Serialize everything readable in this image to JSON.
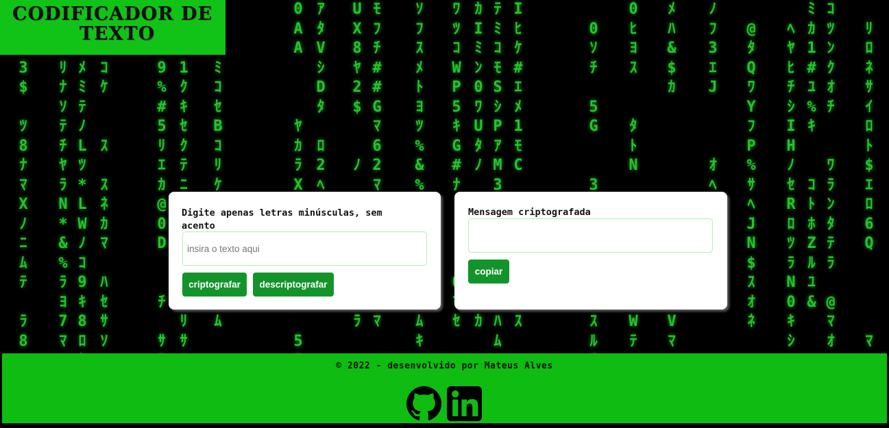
{
  "header": {
    "logo_line1": "CODIFICADOR DE",
    "logo_line2": "TEXTO"
  },
  "input_card": {
    "label": "Digite apenas letras minúsculas, sem acento",
    "placeholder": "insira o texto aqui",
    "encrypt_button": "criptografar",
    "decrypt_button": "descriptografar"
  },
  "output_card": {
    "label": "Mensagem criptografada",
    "copy_button": "copiar"
  },
  "footer": {
    "credit": "© 2022 - desenvolvido por Mateus Alves",
    "links": [
      "github-icon",
      "linkedin-icon"
    ]
  },
  "colors": {
    "rain_green": "#22c52a",
    "header_green": "#11c316",
    "footer_green": "#0fbc12",
    "button_green": "#13942a"
  },
  "background_rain": [
    "ﾀ\nﾊ\nP\n3\n$\n\nﾂ\n8\nﾅ\nﾏ\nX\nﾉ\nﾆ\nﾑ\nﾃ\n\nﾗ\n8\n%",
    "\n\nﾙ\nﾘ\nﾅ\nｿ\nﾃ\nﾁ\nﾔ\nﾗ\nN\n*\n&\n%\nﾗ\nﾖ\n7\nﾏ",
    "\n\nﾁ\nﾒ\nﾐ\nﾃ\nﾉ\nL\nﾂ\n*\nL\nW\nﾉ\nｺ\n9\nｷ\n8\nﾛ\nｾ",
    "\n\nﾂ\nｺ\nｹ\n\n\nｽ\n\nｽ\nﾈ\nｶ\nﾏ\n\nﾊ\nｾ\nｻ\nｿ",
    "\n\nﾀ\n9\n%\n#\n5\nﾘ\nｴ\nｶ\n@\n0\nD\n\n\nﾁ\n\nｻ\n9",
    "\nﾅ\nﾀ\n1\nｸ\nｷ\nｾ\nｸ\nﾃ\nﾆ\nｸ\nﾐ\nｵ\n\n\n\nﾘ\nｻ\nﾂ",
    "\n\nｿ\nﾐ\nｺ\nｾ\nB\nｺ\nﾘ\nｹ\nS\n\n\n\nﾘ\nﾈ\nﾑ",
    "0\nA\nA\n\n\n\nﾔ\nｶ\nﾗ\nX\n\n\n\n\n\n\n\n5\n0",
    "ｱ\nﾀ\nV\nｼ\nD\nﾀ\n\nﾛ\n2\nﾍ\n\n\n\n\nﾅ\nｽ",
    "U\nX\n8\nﾔ\n2\n$\n\n\nﾉ\n\n\n\n\n\n\nﾌ\nﾗ",
    "ﾓ\nﾌ\nﾁ\n#\n#\nG\nﾏ\n6\n2\nﾏ\n\n\n\n\n\nﾊ\nﾏ",
    "ｿ\nﾌ\nｽ\nﾒ\nﾄ\nﾖ\nﾂ\n%\n&\n%\n\n\n\n\n\n\nﾑ\nｷ",
    "ﾜ\nﾂ\nｺ\nW\nP\n5\nｷ\nG\n#\nﾅ\n\n\n\n\n0\nﾏ\nｾ",
    "ｶ\nI\nﾐ\nﾝ\n0\nﾜ\nU\nﾀ\nﾉ\n\n\n\n\n\n\n\nｶ",
    "ﾃ\nﾐ\nｺ\nﾓ\nS\nｼ\nP\nｱ\nM\n3\n\n\n\n\n\n\nﾊ\nﾑ",
    "I\nﾋ\nｹ\n#\nｴ\nﾒ\n1\nﾓ\nC\n\n\n\n\n\nﾇ\nｽ\nｽ",
    "\n0\nｿ\nﾁ\n\n5\nG\n\n\n3\n\n\n\n\n2\n\nｽ\nﾙ\nﾁ",
    "0\nﾋ\nﾖ\nｽ\n\n\nﾀ\nﾄ\nN\n\n\n\n\n\nﾎ\nP\nW\nﾃ",
    "ﾒ\nﾊ\n&\n$\nｶ\n\n\n\n\n\n\n\n\n\nﾊ\nﾏ\nV\nﾏ",
    "ﾉ\nﾌ\n3\nｴ\nJ\n\n\n\nｵ\nﾍ\nJ\n\n\n\n\nﾉ",
    "\n@\nﾀ\nQ\nﾜ\nY\nﾌ\nP\n%\nｻ\nﾍ\nJ\nN\n$\nｽ\nｵ\nﾈ",
    "\nﾍ\nﾔ\nﾋ\nﾁ\nｼ\nI\nH\nﾉ\nｾ\nR\nﾛ\nﾂ\nﾗ\nN\n0\nｷ\nｼ",
    "ﾐ\nｶ\n1\n#\nﾕ\n%\nｷ\n\n\nｺ\nﾄ\nﾎ\nZ\nﾙ\nﾕ\n&",
    "ｺ\nﾂ\nﾝ\nｸ\nｵ\nﾁ\n\n\nﾜ\nﾗ\nﾝ\nﾀ\nﾃ\nﾗ\n\n@\nﾏ\nｵ",
    "\nﾘ\nﾛ\nﾈ\nｻ\nｲ\nﾛ\nﾄ\n$\nｴ\nﾛ\n6\nQ\n\n\n\n\nﾏ"
  ]
}
